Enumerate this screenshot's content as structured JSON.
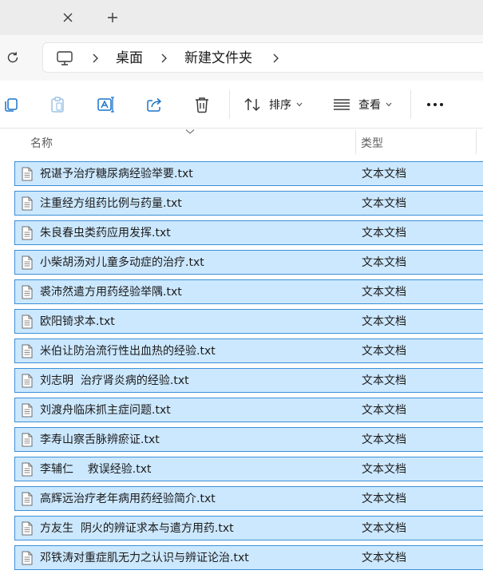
{
  "tabs": {
    "close_icon": "close-icon",
    "add_icon": "plus-icon"
  },
  "address": {
    "refresh_icon": "refresh-icon",
    "pc_icon": "computer-icon",
    "crumbs": [
      "桌面",
      "新建文件夹"
    ]
  },
  "toolbar": {
    "sort_label": "排序",
    "view_label": "查看",
    "more_label": "···"
  },
  "columns": {
    "name": "名称",
    "type": "类型"
  },
  "files": [
    {
      "name": "祝谌予治疗糖尿病经验举要.txt",
      "type": "文本文档"
    },
    {
      "name": "注重经方组药比例与药量.txt",
      "type": "文本文档"
    },
    {
      "name": "朱良春虫类药应用发挥.txt",
      "type": "文本文档"
    },
    {
      "name": "小柴胡汤对儿童多动症的治疗.txt",
      "type": "文本文档"
    },
    {
      "name": "裘沛然遣方用药经验举隅.txt",
      "type": "文本文档"
    },
    {
      "name": "欧阳锜求本.txt",
      "type": "文本文档"
    },
    {
      "name": "米伯让防治流行性出血热的经验.txt",
      "type": "文本文档"
    },
    {
      "name": "刘志明  治疗肾炎病的经验.txt",
      "type": "文本文档"
    },
    {
      "name": "刘渡舟临床抓主症问题.txt",
      "type": "文本文档"
    },
    {
      "name": "李寿山察舌脉辨瘀证.txt",
      "type": "文本文档"
    },
    {
      "name": "李辅仁    救误经验.txt",
      "type": "文本文档"
    },
    {
      "name": "高辉远治疗老年病用药经验简介.txt",
      "type": "文本文档"
    },
    {
      "name": "方友生  阴火的辨证求本与遣方用药.txt",
      "type": "文本文档"
    },
    {
      "name": "邓铁涛对重症肌无力之认识与辨证论治.txt",
      "type": "文本文档"
    }
  ],
  "colors": {
    "selection_bg": "#cce8ff",
    "selection_border": "#3c8fd6"
  }
}
